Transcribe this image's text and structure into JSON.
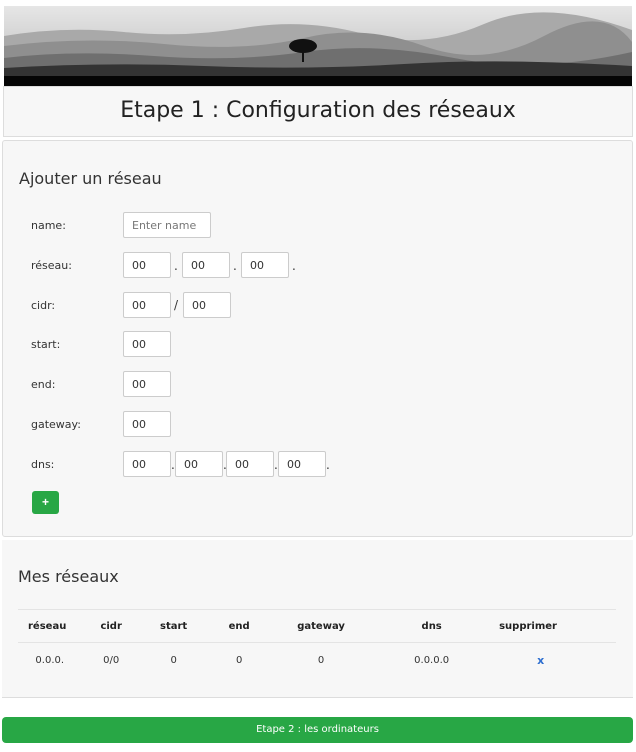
{
  "page": {
    "title": "Etape 1 : Configuration des réseaux"
  },
  "form": {
    "title": "Ajouter un réseau",
    "labels": {
      "name": "name:",
      "reseau": "réseau:",
      "cidr": "cidr:",
      "start": "start:",
      "end": "end:",
      "gateway": "gateway:",
      "dns": "dns:"
    },
    "name_placeholder": "Enter name",
    "reseau": [
      "00",
      "00",
      "00"
    ],
    "cidr": [
      "00",
      "00"
    ],
    "start": "00",
    "end": "00",
    "gateway": "00",
    "dns": [
      "00",
      "00",
      "00",
      "00"
    ],
    "dot": ".",
    "slash": "/",
    "add_label": "+"
  },
  "networks": {
    "title": "Mes réseaux",
    "columns": [
      "réseau",
      "cidr",
      "start",
      "end",
      "gateway",
      "dns",
      "supprimer"
    ],
    "rows": [
      {
        "reseau": "0.0.0.",
        "cidr": "0/0",
        "start": "0",
        "end": "0",
        "gateway": "0",
        "dns": "0.0.0.0",
        "delete": "x"
      }
    ]
  },
  "next_button": "Etape 2 : les ordinateurs",
  "colors": {
    "accent": "#28a745",
    "delete": "#2f6fd0"
  }
}
